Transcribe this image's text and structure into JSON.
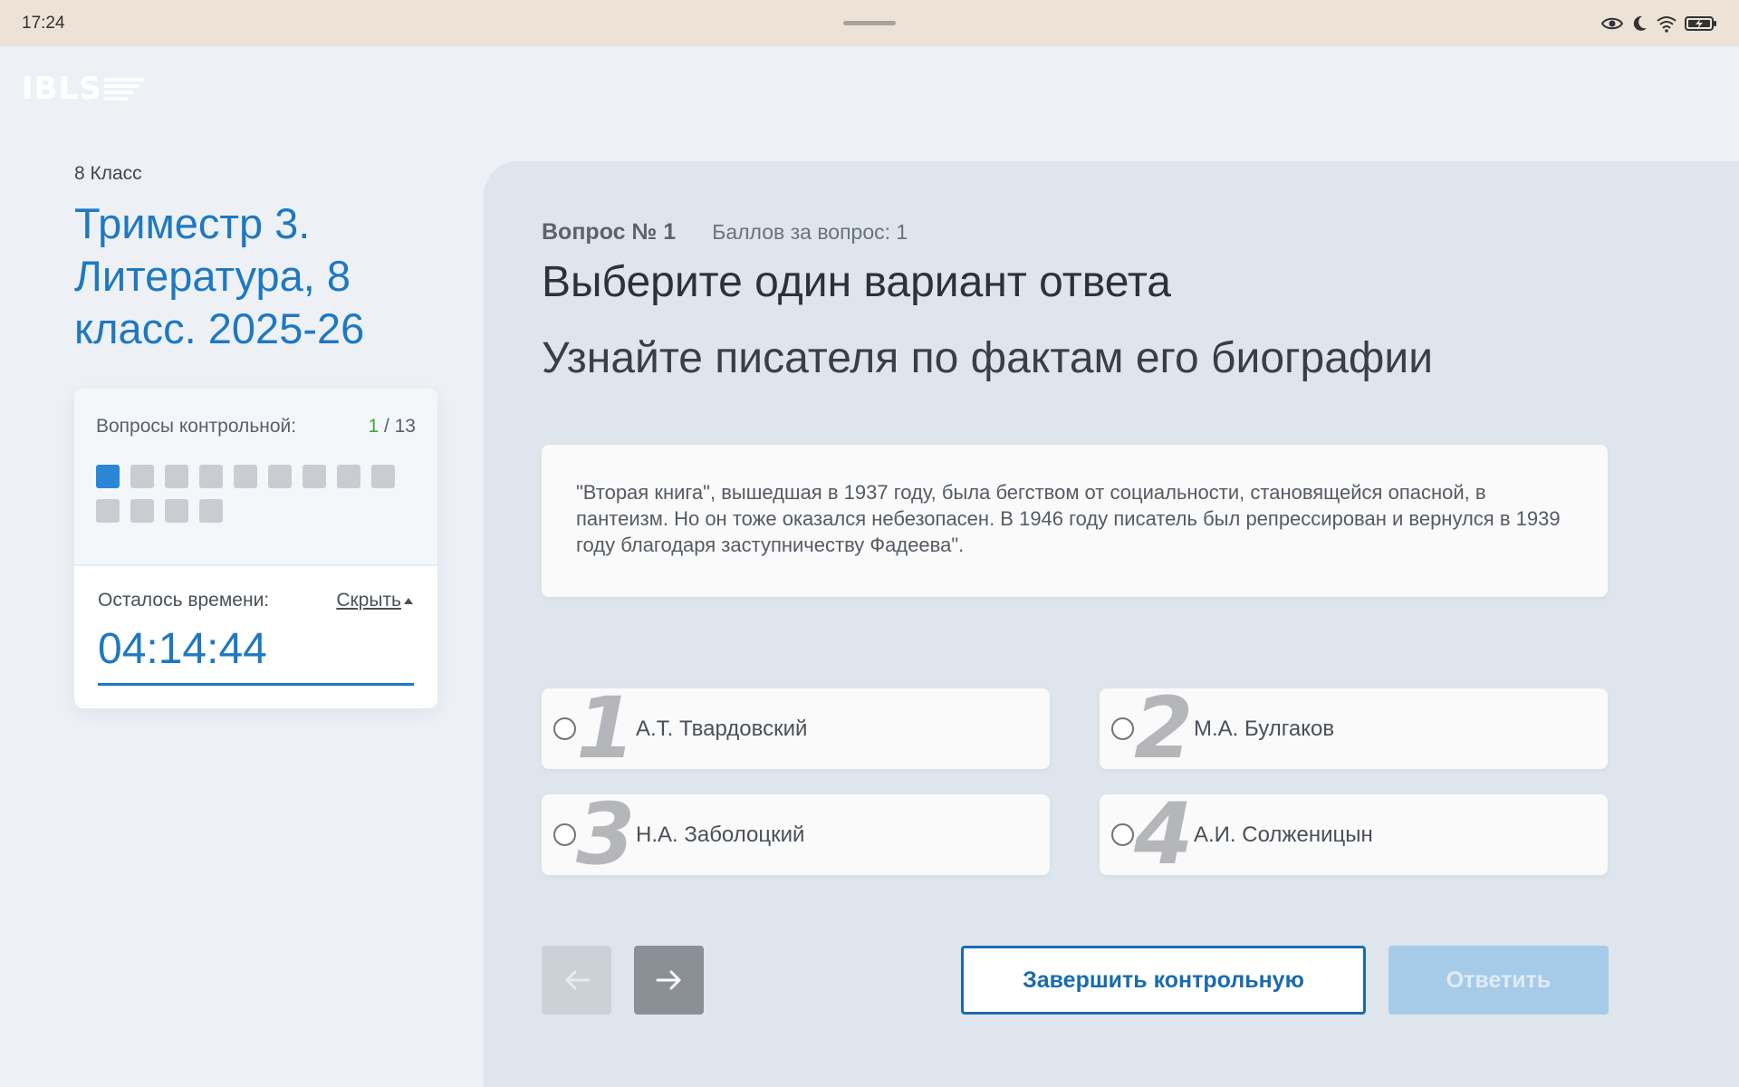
{
  "status_bar": {
    "time": "17:24",
    "icons": [
      "eye-icon",
      "moon-icon",
      "wifi-icon",
      "battery-charging-icon"
    ]
  },
  "logo": {
    "text": "IBLS"
  },
  "sidebar": {
    "grade": "8 Класс",
    "course_title": "Триместр 3. Литература, 8 класс. 2025-26",
    "questions_label": "Вопросы контрольной:",
    "current_question": "1",
    "total_questions": " / 13",
    "question_cells": [
      {
        "active": true
      },
      {
        "active": false
      },
      {
        "active": false
      },
      {
        "active": false
      },
      {
        "active": false
      },
      {
        "active": false
      },
      {
        "active": false
      },
      {
        "active": false
      },
      {
        "active": false
      },
      {
        "active": false
      },
      {
        "active": false
      },
      {
        "active": false
      },
      {
        "active": false
      }
    ],
    "time_left_label": "Осталось времени:",
    "hide_label": "Скрыть",
    "timer": "04:14:44"
  },
  "question": {
    "number_label": "Вопрос № 1",
    "points_label": "Баллов за вопрос: 1",
    "instruction": "Выберите один вариант ответа",
    "text": "Узнайте писателя по фактам его биографии",
    "passage": "\"Вторая книга\", вышедшая в 1937 году, была бегством от социальности, становящейся опасной, в пантеизм. Но он тоже оказался небезопасен. В 1946 году писатель был репрессирован и вернулся в 1939 году благодаря заступничеству Фадеева\".",
    "options": [
      {
        "num": "1",
        "label": "А.Т. Твардовский"
      },
      {
        "num": "2",
        "label": "М.А. Булгаков"
      },
      {
        "num": "3",
        "label": "Н.А. Заболоцкий"
      },
      {
        "num": "4",
        "label": "А.И. Солженицын"
      }
    ]
  },
  "actions": {
    "finish_label": "Завершить контрольную",
    "answer_label": "Ответить"
  },
  "colors": {
    "accent": "#1f78c1",
    "active_cell": "#2b87d6",
    "current_count": "#42a548"
  }
}
